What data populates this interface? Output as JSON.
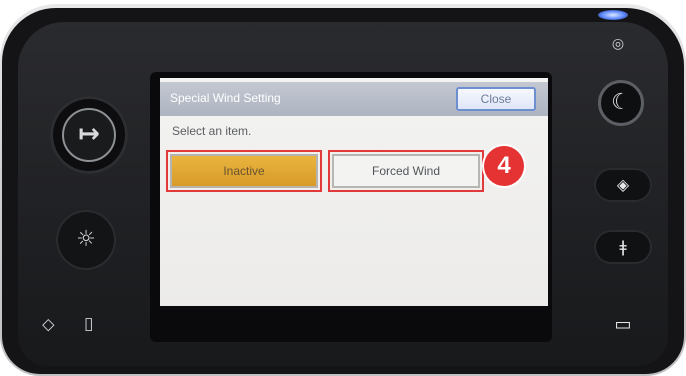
{
  "screen": {
    "title": "Special Wind Setting",
    "close_label": "Close",
    "prompt": "Select an item.",
    "options": [
      {
        "label": "Inactive",
        "selected": true
      },
      {
        "label": "Forced Wind",
        "selected": false
      }
    ]
  },
  "annotation": {
    "step_number": "4",
    "highlight_color": "#e23a3a"
  },
  "panel_icons": {
    "left_big": "login-arrow-icon",
    "left_small": "brightness-icon",
    "left_bottom": [
      "tray-icon",
      "document-icon"
    ],
    "right_top": "power-indicator-icon",
    "right_moon": "energy-saver-moon-icon",
    "right_mid": "check-status-icon",
    "right_lower": "key-icon",
    "right_bottom": "sim-card-icon"
  },
  "colors": {
    "selected_option": "#d89b2a",
    "header": "#aeb4c0",
    "badge": "#e53232",
    "led": "#5b86ff"
  }
}
